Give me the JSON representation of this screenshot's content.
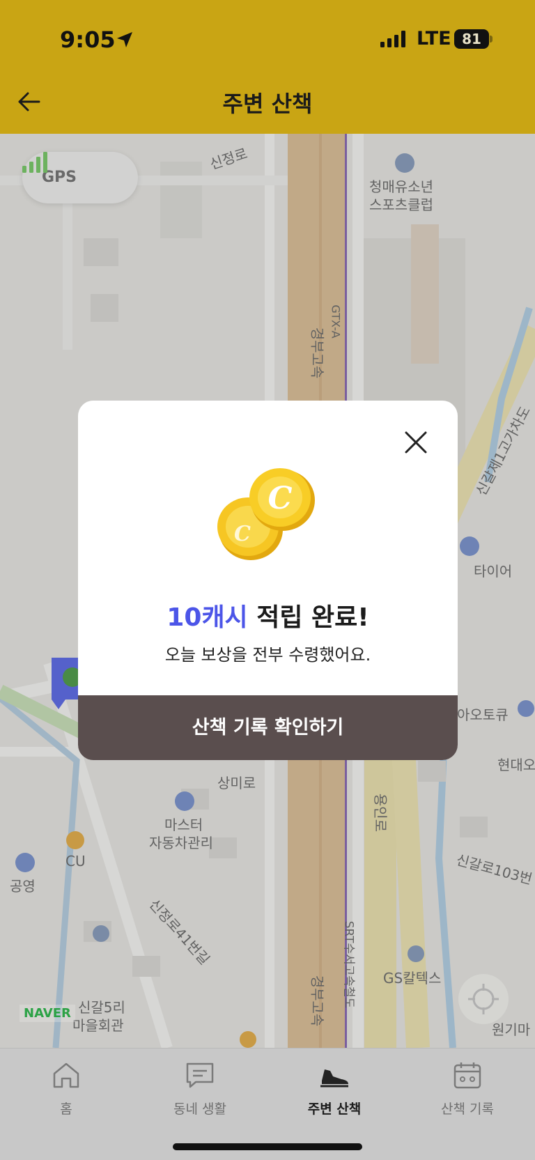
{
  "status_bar": {
    "time": "9:05",
    "network": "LTE",
    "battery": "81"
  },
  "header": {
    "title": "주변 산책"
  },
  "map": {
    "gps_label": "GPS",
    "watermark": "NAVER",
    "labels": {
      "sinjeong_ro": "신정로",
      "youth_club_1": "청매유소년",
      "youth_club_2": "스포츠클럽",
      "gtx": "GTX-A",
      "expressway_top": "경부고속",
      "sin_gal_road": "신갈제1고가차도",
      "tire": "타이어",
      "autoq": "아오토큐",
      "hyundai": "현대오",
      "sangmi": "상미로",
      "master_1": "마스터",
      "master_2": "자동차관리",
      "cu": "CU",
      "park": "공영",
      "sinjeong41": "신정로41번길",
      "expressway_bottom": "경부고속",
      "srt": "SRT수서고속철도",
      "yongin": "용인로",
      "singal103": "신갈로103번",
      "gs": "GS칼텍스",
      "village_1": "신갈5리",
      "village_2": "마을회관",
      "wongi": "원기마"
    }
  },
  "modal": {
    "reward_amount": "10캐시",
    "headline_rest": " 적립 완료!",
    "subtitle": "오늘 보상을 전부 수령했어요.",
    "cta": "산책 기록 확인하기",
    "coin_letter": "C"
  },
  "tabs": [
    {
      "label": "홈",
      "icon": "home-icon"
    },
    {
      "label": "동네 생활",
      "icon": "chat-icon"
    },
    {
      "label": "주변 산책",
      "icon": "sneaker-icon",
      "active": true
    },
    {
      "label": "산책 기록",
      "icon": "calendar-icon"
    }
  ],
  "colors": {
    "header": "#c9a514",
    "accent": "#4c55e8",
    "cta": "#5a4e4e",
    "gps_bars": "#6bbf59"
  }
}
